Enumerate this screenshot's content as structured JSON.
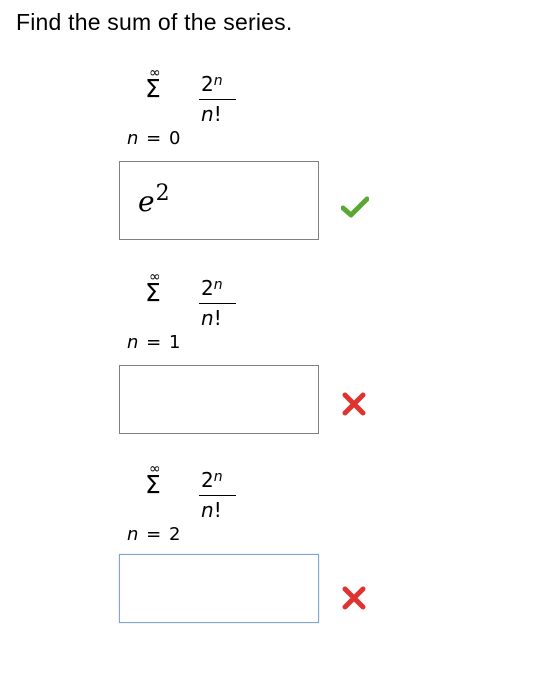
{
  "question": {
    "title": "Find the sum of the series."
  },
  "parts": [
    {
      "upper": "∞",
      "sigma": "Σ",
      "lower_var": "n",
      "lower_rest": " = 0",
      "num_base": "2",
      "num_exp": "n",
      "den_var": "n",
      "den_rest": "!",
      "answer_base": "e",
      "answer_exp": "2",
      "status": "correct",
      "status_color": "#5aa832",
      "status_icon": "check-icon"
    },
    {
      "upper": "∞",
      "sigma": "Σ",
      "lower_var": "n",
      "lower_rest": " = 1",
      "num_base": "2",
      "num_exp": "n",
      "den_var": "n",
      "den_rest": "!",
      "answer_base": "",
      "answer_exp": "",
      "status": "incorrect",
      "status_color": "#e0322e",
      "status_icon": "cross-icon"
    },
    {
      "upper": "∞",
      "sigma": "Σ",
      "lower_var": "n",
      "lower_rest": " = 2",
      "num_base": "2",
      "num_exp": "n",
      "den_var": "n",
      "den_rest": "!",
      "answer_base": "",
      "answer_exp": "",
      "status": "incorrect",
      "status_color": "#e0322e",
      "status_icon": "cross-icon"
    }
  ]
}
